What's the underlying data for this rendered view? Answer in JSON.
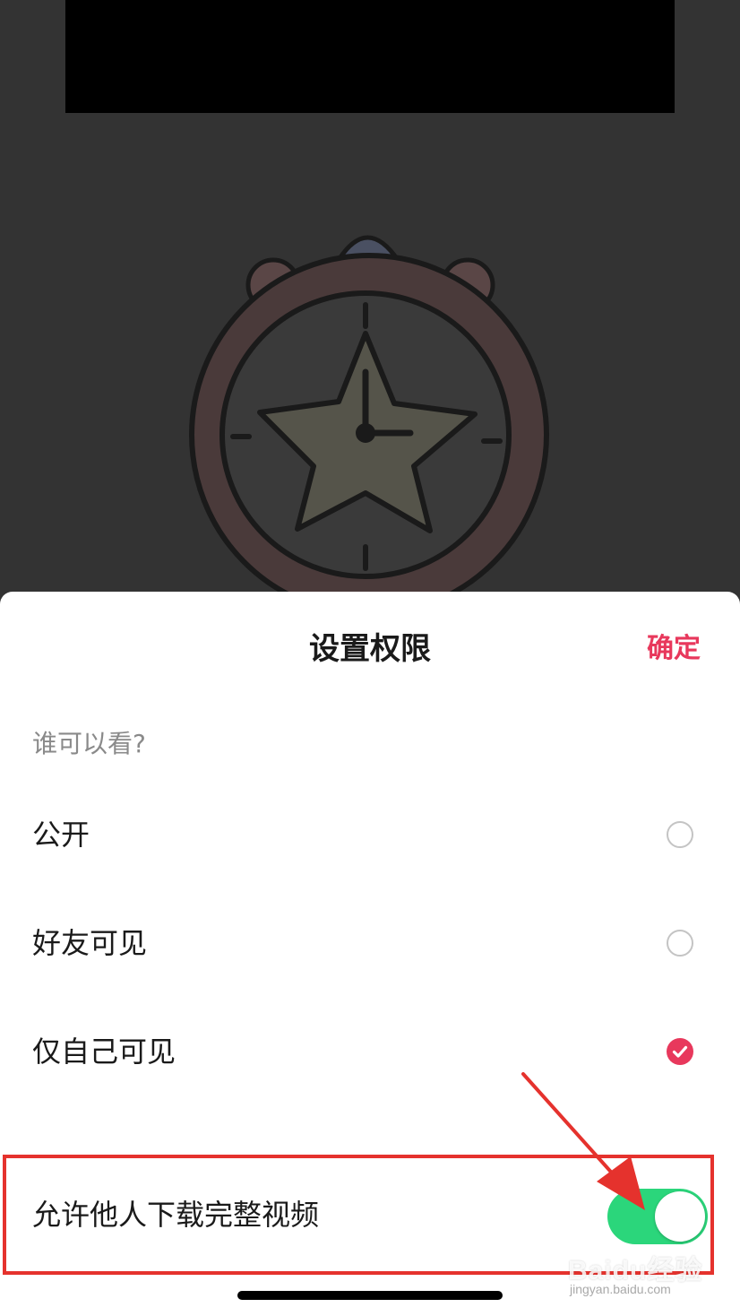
{
  "sheet": {
    "title": "设置权限",
    "confirm_label": "确定",
    "section_label": "谁可以看?"
  },
  "visibility_options": [
    {
      "label": "公开",
      "selected": false
    },
    {
      "label": "好友可见",
      "selected": false
    },
    {
      "label": "仅自己可见",
      "selected": true
    }
  ],
  "download_setting": {
    "label": "允许他人下载完整视频",
    "enabled": true
  },
  "watermark": {
    "main": "Baidu经验",
    "sub": "jingyan.baidu.com"
  },
  "colors": {
    "accent": "#e8385c",
    "toggle_on": "#2bd67b",
    "annotation": "#e5322d",
    "overlay": "#333333"
  },
  "icons": {
    "selected_radio": "checkmark-circle-icon",
    "unselected_radio": "empty-circle-icon",
    "annotation_arrow": "red-arrow-icon",
    "background_art": "alarm-clock-star-illustration"
  }
}
